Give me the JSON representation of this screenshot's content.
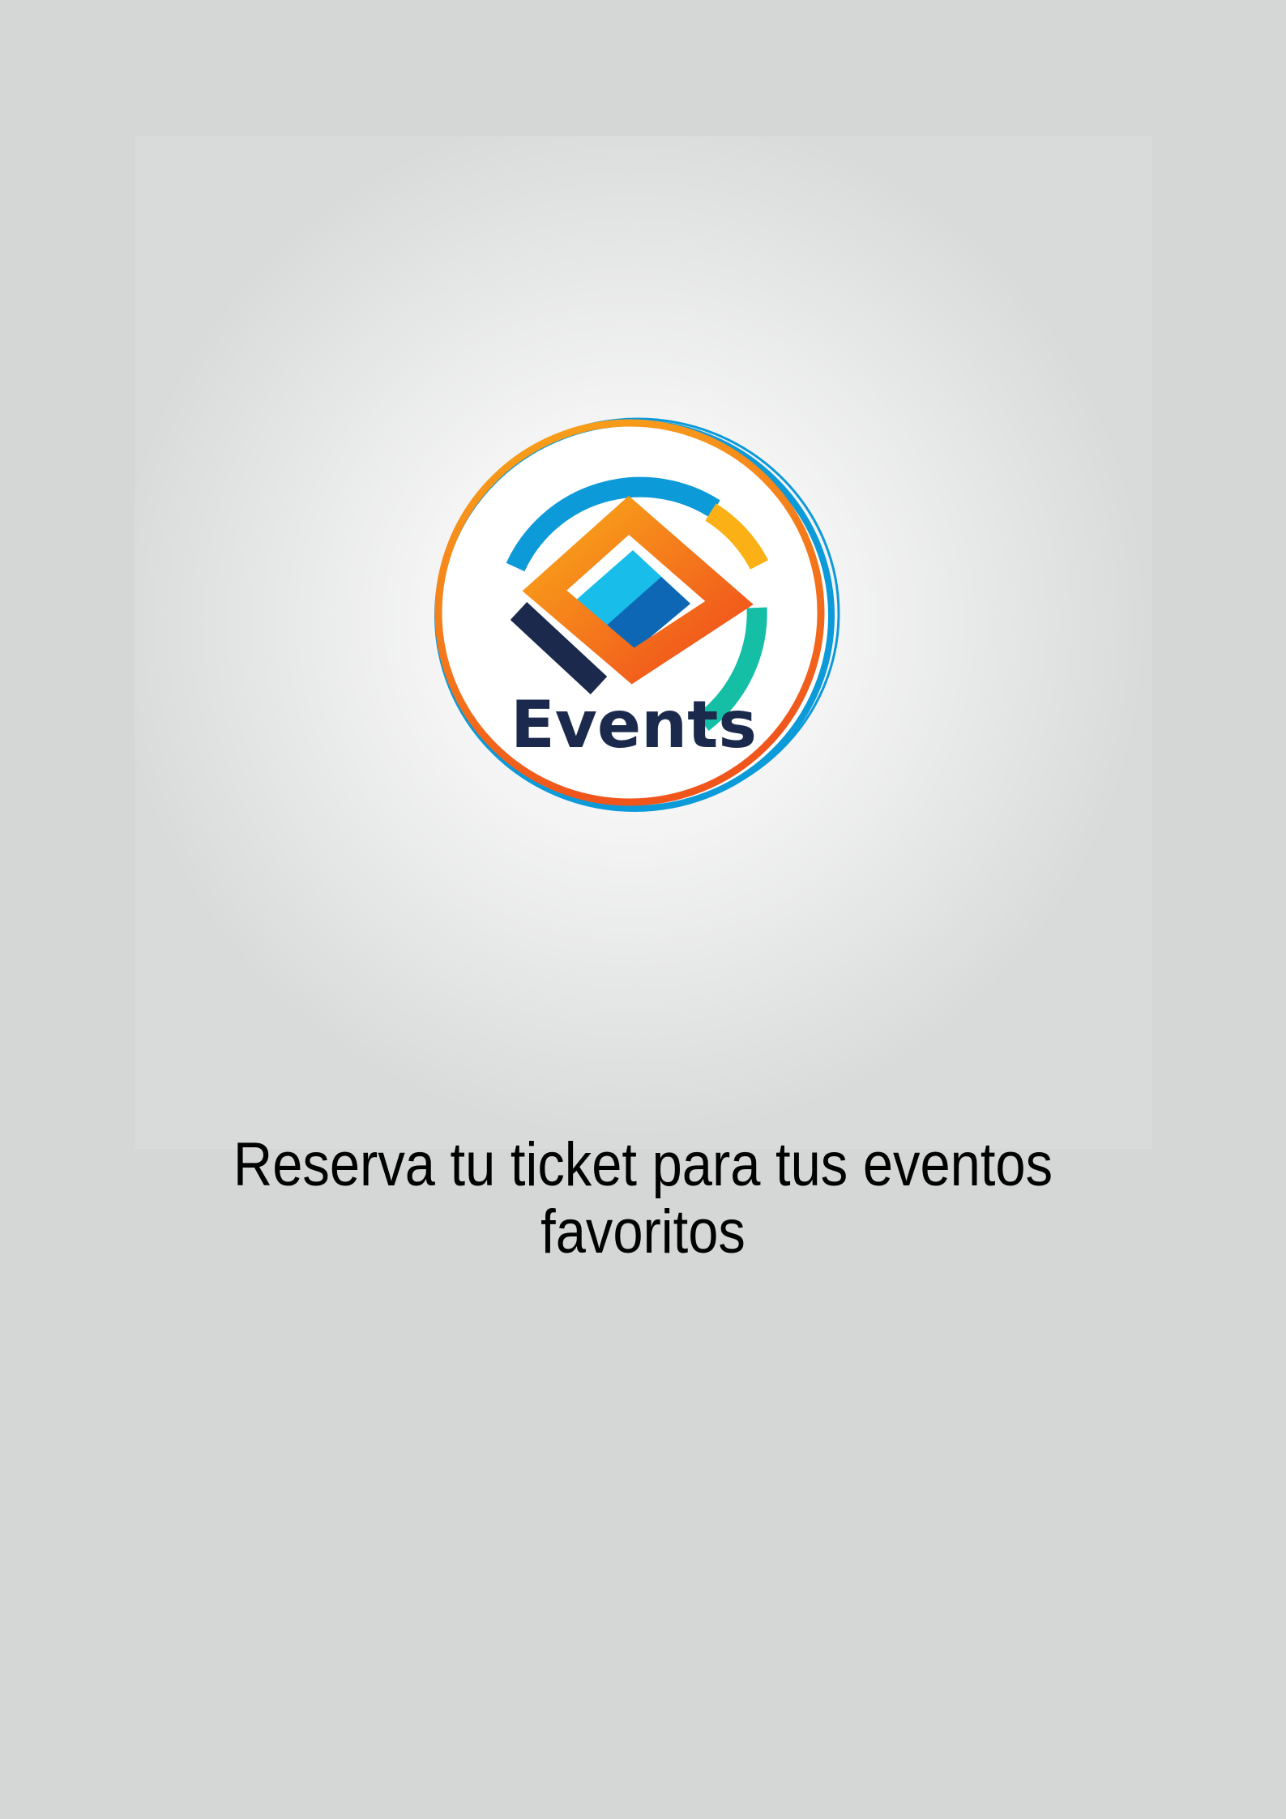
{
  "logo": {
    "wordmark": "Events",
    "colors": {
      "orange": "#f7941d",
      "red_orange": "#f04e1c",
      "blue": "#0c9ad8",
      "light_blue": "#18bde9",
      "dark_blue": "#0d67b5",
      "yellow": "#fbb116",
      "teal": "#15bfa6",
      "navy": "#1b2a4c"
    }
  },
  "tagline": {
    "line1": "Reserva tu ticket para tus eventos",
    "line2": "favoritos"
  }
}
